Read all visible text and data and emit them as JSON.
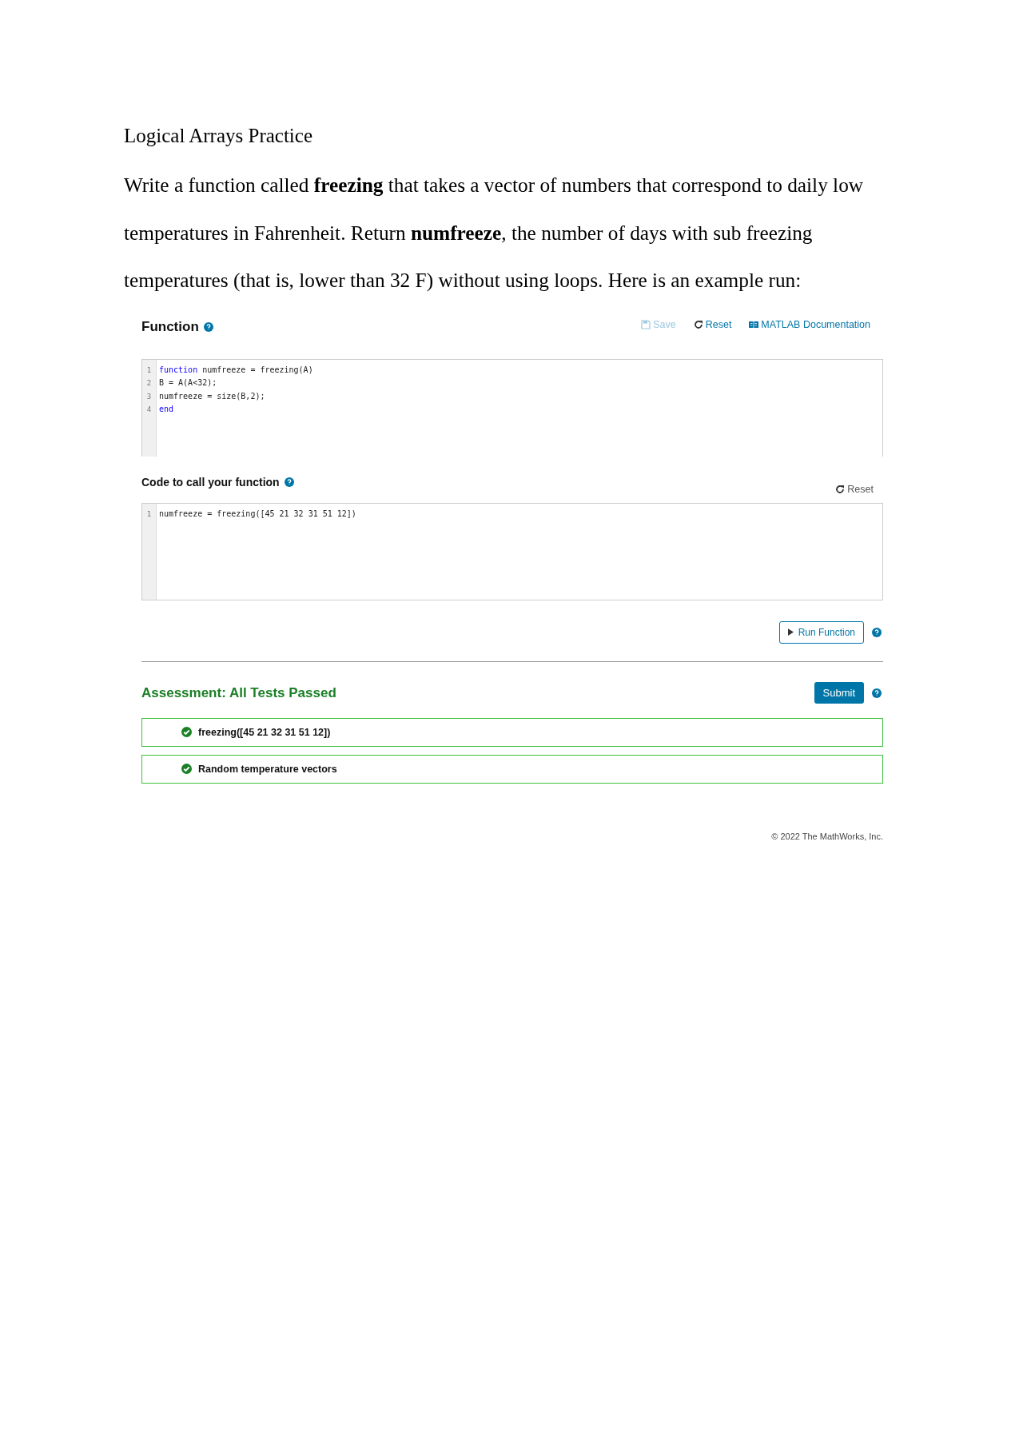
{
  "title": "Logical Arrays Practice",
  "paragraph": "Write a function called **freezing** that takes a vector of numbers that correspond to daily low temperatures in Fahrenheit. Return **numfreeze**, the number of days with sub freezing temperatures (that is, lower than 32 F) without using loops. Here is an example run:",
  "function_panel": {
    "heading": "Function",
    "actions": [
      {
        "label": "Save",
        "kind": "save",
        "disabled": true
      },
      {
        "label": "Reset",
        "kind": "reset",
        "disabled": false
      },
      {
        "label": "MATLAB Documentation",
        "kind": "documentation",
        "disabled": false
      }
    ],
    "lines": [
      {
        "number": "1",
        "tokens": [
          {
            "kind": "keyword",
            "text": "function"
          },
          {
            "kind": "plain",
            "text": " numfreeze = freezing(A)"
          }
        ]
      },
      {
        "number": "2",
        "tokens": [
          {
            "kind": "plain",
            "text": "B = A(A<32);"
          }
        ]
      },
      {
        "number": "3",
        "tokens": [
          {
            "kind": "plain",
            "text": "numfreeze = size(B,2);"
          }
        ]
      },
      {
        "number": "4",
        "tokens": [
          {
            "kind": "keyword",
            "text": "end"
          }
        ]
      }
    ]
  },
  "call_panel": {
    "heading": "Code to call your function",
    "reset": "Reset",
    "lines": [
      {
        "number": "1",
        "tokens": [
          {
            "kind": "plain",
            "text": "numfreeze = freezing([45 21 32 31 51 12])"
          }
        ]
      }
    ],
    "run_button": "Run Function"
  },
  "assessment": {
    "heading": "Assessment: All Tests Passed",
    "submit": "Submit",
    "tests": [
      {
        "label": "freezing([45 21 32 31 51 12])",
        "passed": true
      },
      {
        "label": "Random temperature vectors",
        "passed": true
      }
    ]
  },
  "footer": "© 2022 The MathWorks, Inc."
}
